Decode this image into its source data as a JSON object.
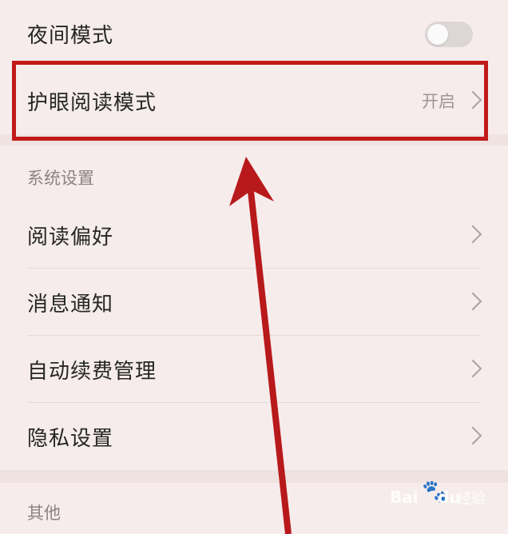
{
  "settings": {
    "night_mode": {
      "label": "夜间模式",
      "enabled": false
    },
    "eye_care": {
      "label": "护眼阅读模式",
      "value": "开启"
    },
    "system_section": {
      "title": "系统设置",
      "items": [
        {
          "label": "阅读偏好"
        },
        {
          "label": "消息通知"
        },
        {
          "label": "自动续费管理"
        },
        {
          "label": "隐私设置"
        }
      ]
    },
    "other_section": {
      "title": "其他"
    }
  },
  "annotation": {
    "highlight_color": "#c11a1a",
    "arrow_color": "#b8191a"
  },
  "watermark": {
    "text": "Baidu经验",
    "bai": "Bai",
    "du": "du",
    "jingyan": "经验"
  }
}
